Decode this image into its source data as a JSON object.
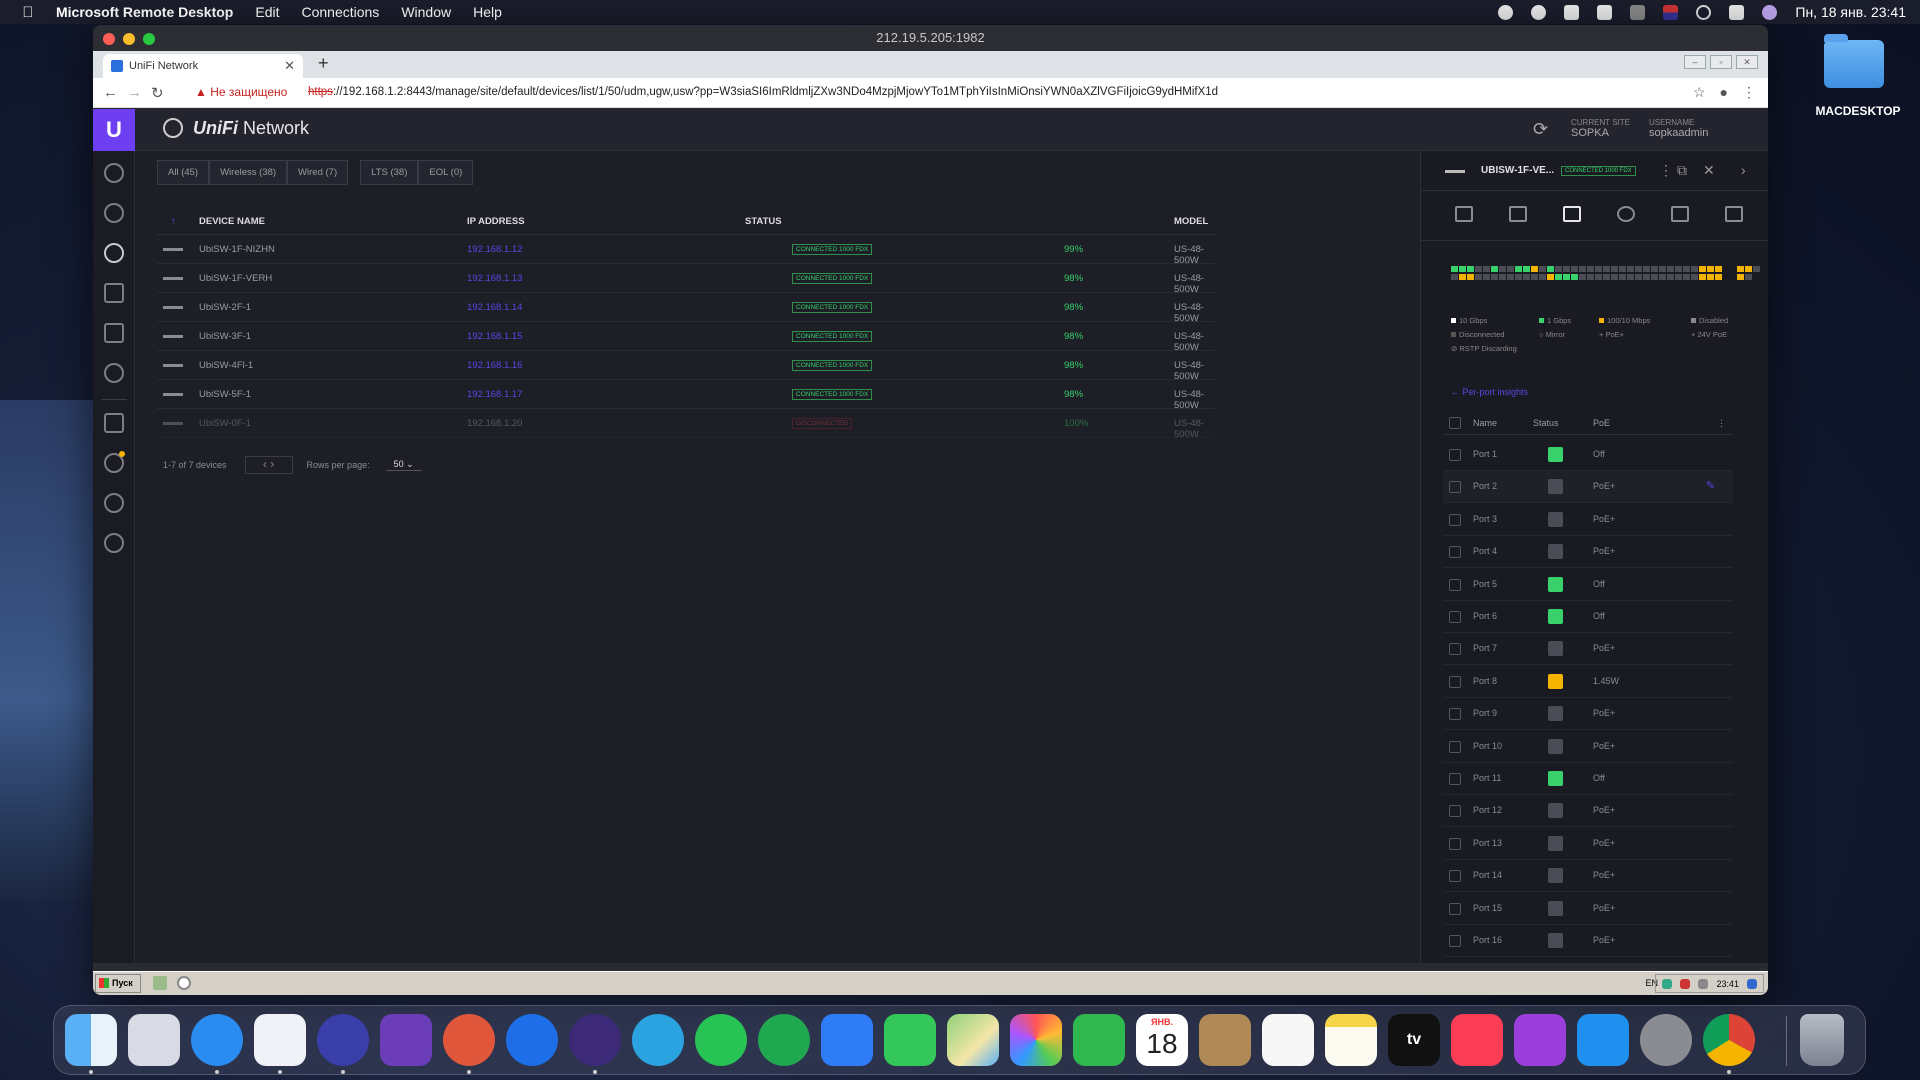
{
  "menubar": {
    "app_name": "Microsoft Remote Desktop",
    "menus": [
      "Edit",
      "Connections",
      "Window",
      "Help"
    ],
    "clock": "Пн, 18 янв.  23:41"
  },
  "desktop": {
    "folder_label": "MACDESKTOP"
  },
  "window": {
    "title": "212.19.5.205:1982"
  },
  "browser": {
    "tab_title": "UniFi Network",
    "security_label": "Не защищено",
    "url_scheme": "https",
    "url_rest": "://192.168.1.2:8443/manage/site/default/devices/list/1/50/udm,ugw,usw?pp=W3siaSI6ImRldmljZXw3NDo4MzpjMjowYTo1MTphYiIsInMiOnsiYWN0aXZlVGFiIjoicG9ydHMifX1d"
  },
  "unifi": {
    "brand_prefix": "UniFi",
    "brand_suffix": "Network",
    "current_site_label": "CURRENT SITE",
    "current_site": "SOPKA",
    "username_label": "USERNAME",
    "username": "sopkaadmin",
    "filters": [
      "All (45)",
      "Wireless (38)",
      "Wired (7)",
      "LTS (38)",
      "EOL (0)"
    ],
    "columns": {
      "name": "DEVICE NAME",
      "ip": "IP ADDRESS",
      "status": "STATUS",
      "model": "MODEL"
    },
    "devices": [
      {
        "name": "UbiSW-1F-NIZHN",
        "ip": "192.168.1.12",
        "status": "CONNECTED 1000 FDX",
        "pct": "99%",
        "model": "US-48-500W"
      },
      {
        "name": "UbiSW-1F-VERH",
        "ip": "192.168.1.13",
        "status": "CONNECTED 1000 FDX",
        "pct": "98%",
        "model": "US-48-500W"
      },
      {
        "name": "UbiSW-2F-1",
        "ip": "192.168.1.14",
        "status": "CONNECTED 1000 FDX",
        "pct": "98%",
        "model": "US-48-500W"
      },
      {
        "name": "UbiSW-3F-1",
        "ip": "192.168.1.15",
        "status": "CONNECTED 1000 FDX",
        "pct": "98%",
        "model": "US-48-500W"
      },
      {
        "name": "UbiSW-4Fl-1",
        "ip": "192.168.1.16",
        "status": "CONNECTED 1000 FDX",
        "pct": "98%",
        "model": "US-48-500W"
      },
      {
        "name": "UbiSW-5F-1",
        "ip": "192.168.1.17",
        "status": "CONNECTED 1000 FDX",
        "pct": "98%",
        "model": "US-48-500W"
      },
      {
        "name": "UbiSW-0F-1",
        "ip": "192.168.1.20",
        "status": "DISCONNECTED",
        "pct": "100%",
        "model": "US-48-500W"
      }
    ],
    "pager_text": "1-7 of 7 devices",
    "rows_per_page_label": "Rows per page:",
    "rows_per_page": "50"
  },
  "panel": {
    "device_name": "UBISW-1F-VE...",
    "device_status": "CONNECTED 1000 FDX",
    "legend": [
      "10 Gbps",
      "1 Gbps",
      "100/10 Mbps",
      "Disabled",
      "Disconnected",
      "Mirror",
      "PoE+",
      "24V PoE",
      "RSTP Discarding"
    ],
    "insights_link": "Per-port insights",
    "port_columns": {
      "name": "Name",
      "status": "Status",
      "poe": "PoE"
    },
    "ports": [
      {
        "name": "Port 1",
        "state": "g",
        "poe": "Off"
      },
      {
        "name": "Port 2",
        "state": "n",
        "poe": "PoE+"
      },
      {
        "name": "Port 3",
        "state": "n",
        "poe": "PoE+"
      },
      {
        "name": "Port 4",
        "state": "n",
        "poe": "PoE+"
      },
      {
        "name": "Port 5",
        "state": "g",
        "poe": "Off"
      },
      {
        "name": "Port 6",
        "state": "g",
        "poe": "Off"
      },
      {
        "name": "Port 7",
        "state": "n",
        "poe": "PoE+"
      },
      {
        "name": "Port 8",
        "state": "y",
        "poe": "1.45W"
      },
      {
        "name": "Port 9",
        "state": "n",
        "poe": "PoE+"
      },
      {
        "name": "Port 10",
        "state": "n",
        "poe": "PoE+"
      },
      {
        "name": "Port 11",
        "state": "g",
        "poe": "Off"
      },
      {
        "name": "Port 12",
        "state": "n",
        "poe": "PoE+"
      },
      {
        "name": "Port 13",
        "state": "n",
        "poe": "PoE+"
      },
      {
        "name": "Port 14",
        "state": "n",
        "poe": "PoE+"
      },
      {
        "name": "Port 15",
        "state": "n",
        "poe": "PoE+"
      },
      {
        "name": "Port 16",
        "state": "n",
        "poe": "PoE+"
      }
    ],
    "port_grid_top": "gggnngnnggyngnnnnnnnnnnnnnnnnnnyyyyyn",
    "port_grid_bottom": "nyynnnnnnnnnygggnnnnnnnnnnnnnnnyyyyn"
  },
  "taskbar": {
    "start_label": "Пуск",
    "lang": "EN",
    "time": "23:41"
  },
  "dock": {
    "calendar_month": "ЯНВ.",
    "calendar_day": "18",
    "tv_label": "tv"
  }
}
